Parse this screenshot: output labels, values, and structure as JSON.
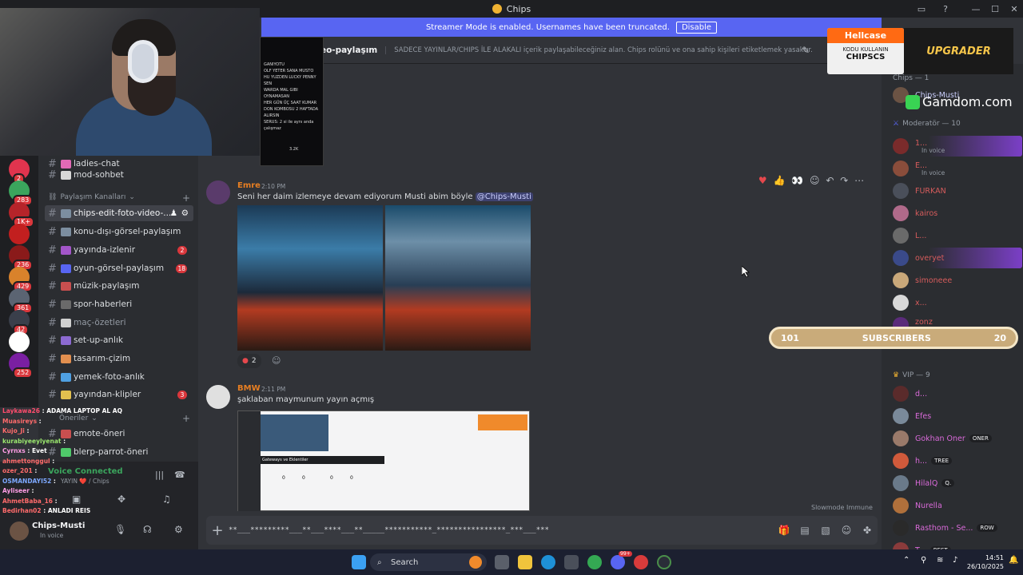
{
  "window": {
    "title": "Chips",
    "controls": [
      "—",
      "☐",
      "✕"
    ]
  },
  "banner": {
    "text": "Streamer Mode is enabled. Usernames have been truncated.",
    "button": "Disable"
  },
  "header": {
    "channel": "edit-foto-video-paylaşım",
    "topic": "SADECE YAYINLAR/CHIPS İLE ALAKALI içerik paylaşabileceğiniz alan. Chips rolünü ve ona sahip kişileri etiketlemek yasaktır."
  },
  "servers": [
    {
      "badge": "2",
      "color": "#e0344e"
    },
    {
      "badge": "283",
      "color": "#3ba55d"
    },
    {
      "badge": "1K+",
      "color": "#b6242a"
    },
    {
      "badge": "",
      "color": "#c21f1f"
    },
    {
      "badge": "236",
      "color": "#8a1a1a"
    },
    {
      "badge": "429",
      "color": "#d9822b"
    },
    {
      "badge": "361",
      "color": "#5b6472"
    },
    {
      "badge": "42",
      "color": "#3a3f4b"
    },
    {
      "badge": "",
      "color": "#ffffff"
    },
    {
      "badge": "252",
      "color": "#7a1fa2"
    }
  ],
  "channels": [
    {
      "name": "ladies-chat",
      "emoji_color": "#e26ab5",
      "style": "bright"
    },
    {
      "name": "mod-sohbet",
      "emoji_color": "#d8d8d8",
      "style": "bright"
    },
    {
      "name": "chips-edit-foto-video-...",
      "emoji_color": "#7c8ea0",
      "style": "active"
    },
    {
      "name": "konu-dışı-görsel-paylaşım",
      "emoji_color": "#7c8ea0",
      "style": "bright"
    },
    {
      "name": "yayında-izlenir",
      "emoji_color": "#a356c9",
      "style": "bright",
      "count": "2"
    },
    {
      "name": "oyun-görsel-paylaşım",
      "emoji_color": "#5865f2",
      "style": "bright",
      "count": "18"
    },
    {
      "name": "müzik-paylaşım",
      "emoji_color": "#c94f4f",
      "style": "bright"
    },
    {
      "name": "spor-haberleri",
      "emoji_color": "#6a6a6a",
      "style": "bright"
    },
    {
      "name": "maç-özetleri",
      "emoji_color": "#d0d0d0",
      "style": "dim"
    },
    {
      "name": "set-up-anlık",
      "emoji_color": "#8c6ad1",
      "style": "bright"
    },
    {
      "name": "tasarım-çizim",
      "emoji_color": "#e28f4f",
      "style": "bright"
    },
    {
      "name": "yemek-foto-anlık",
      "emoji_color": "#4fa0e2",
      "style": "bright"
    },
    {
      "name": "yayından-klipler",
      "emoji_color": "#e2c04f",
      "style": "bright",
      "count": "3"
    },
    {
      "name": "emote-öneri",
      "emoji_color": "#c94f4f",
      "style": "bright"
    },
    {
      "name": "blerp-parrot-öneri",
      "emoji_color": "#4fc96a",
      "style": "bright"
    }
  ],
  "categories": {
    "paylasim": "Paylaşım Kanalları",
    "oneriler": "Öneriler"
  },
  "voice": {
    "status": "Voice Connected",
    "channel": "YAYIN ❤️ / Chips"
  },
  "user": {
    "name": "Chips-Musti",
    "status": "In voice"
  },
  "twitch_chat": [
    {
      "user": "Laykawa26",
      "text": "ADAMA LAPTOP AL AQ",
      "color": "#ff4d6d"
    },
    {
      "user": "Muasireys",
      "text": "",
      "color": "#ff6b6b"
    },
    {
      "user": "Kujo_Ji",
      "text": "",
      "color": "#ff6b6b"
    },
    {
      "user": "kurabiyeeylyenat",
      "text": "",
      "color": "#9ae66e"
    },
    {
      "user": "Cyrnxs",
      "text": "Evet",
      "color": "#ff9ee5"
    },
    {
      "user": "ahmettonggul",
      "text": "",
      "color": "#ff6b6b"
    },
    {
      "user": "ozer_201",
      "text": "",
      "color": "#ff6b6b"
    },
    {
      "user": "OSMANDAYI52",
      "text": "",
      "color": "#7da8ff"
    },
    {
      "user": "Ayliseer",
      "text": "",
      "color": "#ff9ee5"
    },
    {
      "user": "AhmetBaba_16",
      "text": "",
      "color": "#ff6b6b"
    },
    {
      "user": "Bedirhan02",
      "text": "ANLADI REIS",
      "color": "#ff6b6b"
    }
  ],
  "messages": [
    {
      "author": "Emre",
      "time": "2:10 PM",
      "text": "Seni her daim izlemeye devam ediyorum Musti abim böyle",
      "mention": "@Chips-Musti",
      "author_color": "#e67e22",
      "reaction_count": "2"
    },
    {
      "author": "BMW",
      "time": "2:11 PM",
      "text": "şaklaban maymunum yayın açmış",
      "author_color": "#e67e22",
      "screenshot": {
        "label": "Gateways ve Eklentiler",
        "values": [
          "0",
          "0",
          "0",
          "0"
        ]
      }
    }
  ],
  "phone_lines": [
    "GANIYOTU",
    "OLF YETER SANA MUSTO",
    "HU YUZDEN LUCKY PENNY SEN",
    "WARDA MAL GIBI OYNAMASAN",
    "HER GÜN ÜÇ SAAT KUMAR",
    "DON KOMBOSU 2 HAFTADA ALIRSIN",
    "SERUS: 2 si ile aynı anda çalışmaz"
  ],
  "phone_stat": "3.2K",
  "composer": {
    "value": "**___*********___**___****___**_____***********_****************_***___***"
  },
  "slowmode": "Slowmode Immune",
  "members": {
    "role_chips": "Chips — 1",
    "role_mod": "Moderatör — 10",
    "role_vip": "VIP — 9",
    "list": [
      {
        "name": "Chips-Musti",
        "color": "#c9cdfb",
        "status": "",
        "group": "chips"
      },
      {
        "name": "1...",
        "color": "#d65c5c",
        "status": "In voice",
        "group": "mod"
      },
      {
        "name": "E...",
        "color": "#d65c5c",
        "status": "In voice",
        "group": "mod"
      },
      {
        "name": "FURKAN",
        "color": "#d65c5c",
        "status": "",
        "group": "mod"
      },
      {
        "name": "kairos",
        "color": "#d65c5c",
        "status": "",
        "group": "mod"
      },
      {
        "name": "L...",
        "color": "#d65c5c",
        "status": "",
        "group": "mod"
      },
      {
        "name": "overyet",
        "color": "#d65c5c",
        "status": "",
        "group": "mod"
      },
      {
        "name": "simoneee",
        "color": "#d65c5c",
        "status": "",
        "group": "mod"
      },
      {
        "name": "x...",
        "color": "#d65c5c",
        "status": "",
        "group": "mod"
      },
      {
        "name": "zonz",
        "color": "#d65c5c",
        "status": "In voice",
        "group": "mod"
      },
      {
        "name": "d...",
        "color": "#d96ad9",
        "status": "",
        "group": "vip"
      },
      {
        "name": "Efes",
        "color": "#d96ad9",
        "status": "",
        "group": "vip"
      },
      {
        "name": "Gokhan Oner",
        "color": "#d96ad9",
        "status": "",
        "tag": "ONER",
        "group": "vip"
      },
      {
        "name": "h...",
        "color": "#d96ad9",
        "status": "",
        "tag": "TREE",
        "group": "vip"
      },
      {
        "name": "HilalQ",
        "color": "#d96ad9",
        "status": "",
        "tag": "Q.",
        "group": "vip"
      },
      {
        "name": "Nurella",
        "color": "#d96ad9",
        "status": "",
        "group": "vip"
      },
      {
        "name": "Rasthom - Se...",
        "color": "#d96ad9",
        "status": "",
        "tag": "ROW",
        "group": "vip"
      },
      {
        "name": "T...",
        "color": "#d96ad9",
        "status": "",
        "tag": "BEST",
        "group": "vip"
      }
    ]
  },
  "ads": {
    "hellcase_title": "Hellcase",
    "hellcase_sub": "KODU KULLANIN",
    "hellcase_code": "CHIPSCS",
    "upgrader": "UPGRADER",
    "gamdom": "Gamdom.com"
  },
  "subscribers": {
    "left": "101",
    "label": "SUBSCRIBERS",
    "right": "20"
  },
  "taskbar": {
    "search": "Search",
    "time": "14:51",
    "date": "26/10/2025",
    "discord_badge": "99+"
  },
  "colors": {
    "blurple": "#5865f2",
    "bg_primary": "#313338",
    "bg_secondary": "#2b2d31",
    "bg_tertiary": "#1e1f22"
  }
}
